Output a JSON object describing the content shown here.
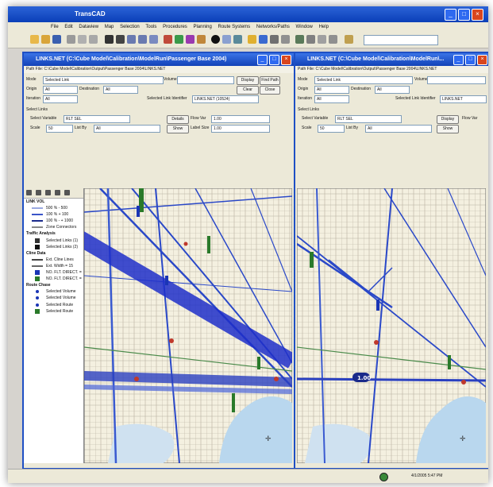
{
  "app": {
    "title": "TransCAD"
  },
  "menu": [
    "File",
    "Edit",
    "Dataview",
    "Map",
    "Selection",
    "Tools",
    "Procedures",
    "Planning",
    "Route Systems",
    "Networks/Paths",
    "Window",
    "Help"
  ],
  "toolbar": {
    "select_value": ""
  },
  "left_window": {
    "title": "LINKS.NET (C:\\Cube Model\\Calibration\\ModelRun\\Passenger Base 2004)",
    "path": "Path File: C:\\Cube Model\\Calibration\\Output\\Passenger Base 2004\\LINKS.NET",
    "mode_label": "Mode",
    "mode_value": "Selected Link",
    "origin_label": "Origin",
    "origin_value": "All",
    "destination_label": "Destination",
    "destination_value": "All",
    "iteration_label": "Iteration",
    "iteration_value": "All",
    "volume_label": "Volume",
    "volume_value": "",
    "selected_links_label": "Selected Link Identifier",
    "selected_links_value": "LINKS.NET (10524)",
    "buttons": {
      "display": "Display",
      "find": "Find Path",
      "clear": "Clear",
      "close": "Close",
      "details": "Details",
      "show": "Show"
    },
    "group_label": "Select Links",
    "link_var_label": "Select Variable",
    "link_var_value": "RLT SEL",
    "scale_label": "Scale",
    "scale_value": "50",
    "list_label": "List By",
    "list_value": "All",
    "flow_label": "Flow Var",
    "flow_value": "1.00",
    "label_size_label": "Label Size",
    "label_size_value": "1.00"
  },
  "right_window": {
    "title": "LINKS.NET (C:\\Cube Model\\Calibration\\ModelRun\\...",
    "path": "Path File: C:\\Cube Model\\Calibration\\Output\\Passenger Base 2004\\LINKS.NET",
    "mode_label": "Mode",
    "mode_value": "Selected Link",
    "origin_label": "Origin",
    "origin_value": "All",
    "destination_label": "Destination",
    "destination_value": "All",
    "iteration_label": "Iteration",
    "iteration_value": "All",
    "volume_label": "Volume",
    "volume_value": "",
    "selected_links_label": "Selected Link Identifier",
    "selected_links_value": "LINKS.NET",
    "buttons": {
      "display": "Display",
      "show": "Show"
    },
    "group_label": "Select Links",
    "link_var_label": "Select Variable",
    "link_var_value": "RLT SEL",
    "scale_label": "Scale",
    "scale_value": "50",
    "list_label": "List By",
    "list_value": "All",
    "flow_label": "Flow Var"
  },
  "legend": {
    "items": [
      {
        "label": "LINK VOL",
        "type": "header"
      },
      {
        "label": "500 % - 500",
        "type": "line",
        "color": "#9aa8e0"
      },
      {
        "label": "100 % + 100",
        "type": "line",
        "color": "#3a55c8"
      },
      {
        "label": "100 % - + 1000",
        "type": "line",
        "color": "#1b2a8c"
      },
      {
        "label": "Zone Connectors",
        "type": "line",
        "color": "#888888"
      },
      {
        "label": "Traffic Analysis",
        "type": "header"
      },
      {
        "label": "Selected Links (1)",
        "type": "square",
        "color": "#333333"
      },
      {
        "label": "Selected Links (2)",
        "type": "square",
        "color": "#111111"
      },
      {
        "label": "Cline Data",
        "type": "header"
      },
      {
        "label": "Ext. Cline Lines",
        "type": "line",
        "color": "#444444"
      },
      {
        "label": "Ext. Width = 15",
        "type": "line",
        "color": "#666666"
      },
      {
        "label": "NO. FLT. DIRECT. =",
        "type": "square",
        "color": "#1a35b5"
      },
      {
        "label": "NO. FLT. DIRECT. =",
        "type": "square",
        "color": "#2a7a2a"
      },
      {
        "label": "Route Chase",
        "type": "header"
      },
      {
        "label": "Selected Volume",
        "type": "dot",
        "color": "#1a35b5"
      },
      {
        "label": "Selected Volume",
        "type": "dot",
        "color": "#1a35b5"
      },
      {
        "label": "Selected Route",
        "type": "dot",
        "color": "#1a35b5"
      },
      {
        "label": "Selected Route",
        "type": "square",
        "color": "#2a7a2a"
      }
    ]
  },
  "map_right": {
    "route_label": "1.00"
  },
  "status": {
    "text": "4/1/2005 5:47 PM"
  }
}
